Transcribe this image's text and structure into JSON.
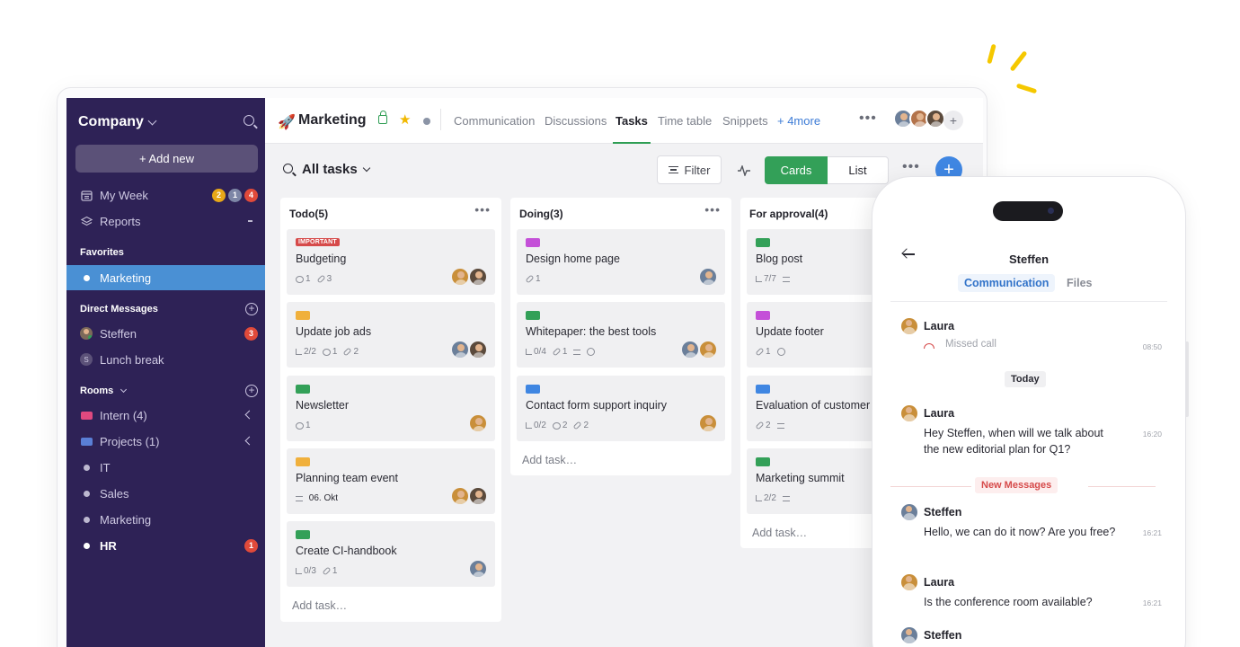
{
  "sidebar": {
    "workspace": "Company",
    "add_new": "+ Add new",
    "nav": [
      {
        "label": "My Week",
        "icon": "calendar-icon",
        "badges": [
          {
            "count": "2",
            "color": "#e8a818"
          },
          {
            "count": "1",
            "color": "#7d86a6"
          },
          {
            "count": "4",
            "color": "#e04a3a"
          }
        ]
      },
      {
        "label": "Reports",
        "icon": "layers-icon"
      }
    ],
    "favorites_title": "Favorites",
    "favorites": [
      {
        "label": "Marketing",
        "active": true
      }
    ],
    "dm_title": "Direct Messages",
    "dms": [
      {
        "label": "Steffen",
        "badge": "3"
      },
      {
        "label": "Lunch break",
        "prefix": "S"
      }
    ],
    "rooms_title": "Rooms",
    "rooms": [
      {
        "label": "Intern (4)",
        "icon": "folder-icon",
        "color": "#e0497f"
      },
      {
        "label": "Projects (1)",
        "icon": "folder-icon",
        "color": "#5a7fd6"
      },
      {
        "label": "IT"
      },
      {
        "label": "Sales"
      },
      {
        "label": "Marketing"
      },
      {
        "label": "HR",
        "badge": "1"
      }
    ]
  },
  "topbar": {
    "title": "Marketing",
    "tabs": [
      "Communication",
      "Discussions",
      "Tasks",
      "Time table",
      "Snippets",
      "+ 4more"
    ],
    "active_tab": "Tasks"
  },
  "toolbar": {
    "title": "All tasks",
    "filter": "Filter",
    "view_cards": "Cards",
    "view_list": "List"
  },
  "columns": [
    {
      "title": "Todo(5)",
      "cards": [
        {
          "tag_text": "IMPORTANT",
          "title": "Budgeting",
          "meta": [
            {
              "icon": "comment-icon",
              "text": "1"
            },
            {
              "icon": "clip-icon",
              "text": "3"
            }
          ],
          "avatars": 2
        },
        {
          "tag": "#f0b03c",
          "title": "Update job ads",
          "meta": [
            {
              "icon": "subtask-icon",
              "text": "2/2"
            },
            {
              "icon": "comment-icon",
              "text": "1"
            },
            {
              "icon": "clip-icon",
              "text": "2"
            }
          ],
          "avatars": 2
        },
        {
          "tag": "#33a058",
          "title": "Newsletter",
          "meta": [
            {
              "icon": "comment-icon",
              "text": "1"
            }
          ],
          "avatars": 1
        },
        {
          "tag": "#f0b03c",
          "title": "Planning team event",
          "meta": [
            {
              "icon": "lines-icon",
              "text": "06. Okt"
            }
          ],
          "avatars": 2
        },
        {
          "tag": "#33a058",
          "title": "Create CI-handbook",
          "meta": [
            {
              "icon": "subtask-icon",
              "text": "0/3"
            },
            {
              "icon": "clip-icon",
              "text": "1"
            }
          ],
          "avatars": 1
        }
      ],
      "add_task": "Add task…"
    },
    {
      "title": "Doing(3)",
      "cards": [
        {
          "tag": "#c450d8",
          "title": "Design home page",
          "meta": [
            {
              "icon": "clip-icon",
              "text": "1"
            }
          ],
          "avatars": 1
        },
        {
          "tag": "#33a058",
          "title": "Whitepaper: the best tools",
          "meta": [
            {
              "icon": "subtask-icon",
              "text": "0/4"
            },
            {
              "icon": "clip-icon",
              "text": "1"
            },
            {
              "icon": "lines-icon",
              "text": ""
            },
            {
              "icon": "clock-icon",
              "text": ""
            }
          ],
          "avatars": 2
        },
        {
          "tag": "#3f86e2",
          "title": "Contact form support inquiry",
          "meta": [
            {
              "icon": "subtask-icon",
              "text": "0/2"
            },
            {
              "icon": "comment-icon",
              "text": "2"
            },
            {
              "icon": "clip-icon",
              "text": "2"
            }
          ],
          "avatars": 1
        }
      ],
      "add_task": "Add task…"
    },
    {
      "title": "For approval(4)",
      "cards": [
        {
          "tag": "#33a058",
          "title": "Blog post",
          "meta": [
            {
              "icon": "subtask-icon",
              "text": "7/7"
            },
            {
              "icon": "lines-icon",
              "text": ""
            }
          ],
          "avatars": 0
        },
        {
          "tag": "#c450d8",
          "title": "Update footer",
          "meta": [
            {
              "icon": "clip-icon",
              "text": "1"
            },
            {
              "icon": "clock-icon",
              "text": ""
            }
          ],
          "avatars": 0
        },
        {
          "tag": "#3f86e2",
          "title": "Evaluation of customer",
          "meta": [
            {
              "icon": "clip-icon",
              "text": "2"
            },
            {
              "icon": "lines-icon",
              "text": ""
            }
          ],
          "avatars": 0
        },
        {
          "tag": "#33a058",
          "title": "Marketing summit",
          "meta": [
            {
              "icon": "subtask-icon",
              "text": "2/2"
            },
            {
              "icon": "lines-icon",
              "text": ""
            }
          ],
          "avatars": 0
        }
      ],
      "add_task": "Add task…"
    }
  ],
  "phone": {
    "contact": "Steffen",
    "tab_active": "Communication",
    "tab_other": "Files",
    "missed_call": {
      "name": "Laura",
      "text": "Missed call",
      "time": "08:50"
    },
    "today": "Today",
    "new_messages": "New Messages",
    "messages": [
      {
        "name": "Laura",
        "text": "Hey Steffen, when will we talk about the new editorial plan for Q1?",
        "time": "16:20"
      },
      {
        "name": "Steffen",
        "text": "Hello, we can do it now? Are you free?",
        "time": "16:21"
      },
      {
        "name": "Laura",
        "text": "Is the conference room available?",
        "time": "16:21"
      },
      {
        "name": "Steffen",
        "text": "",
        "time": ""
      }
    ]
  }
}
